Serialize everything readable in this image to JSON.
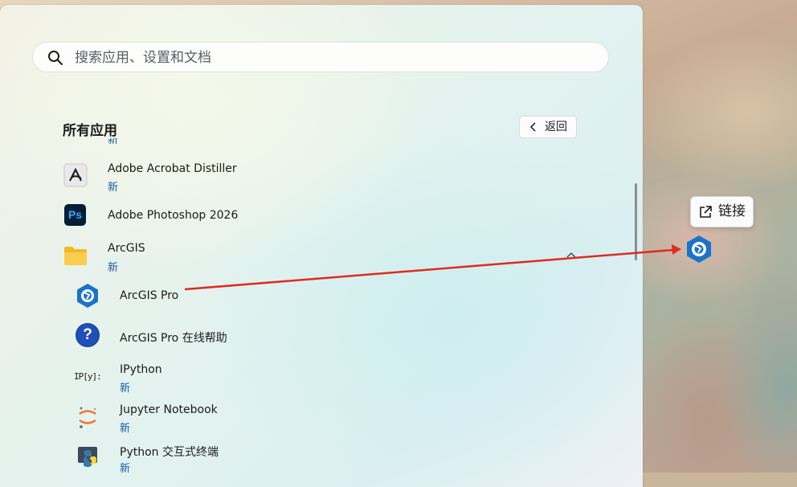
{
  "search": {
    "placeholder": "搜索应用、设置和文档"
  },
  "section": {
    "title": "所有应用"
  },
  "back_button": {
    "label": "返回"
  },
  "new_badge": "新",
  "apps": [
    {
      "name": "Adobe Acrobat Distiller",
      "badge": "新",
      "icon": "acrobat-distiller-icon"
    },
    {
      "name": "Adobe Photoshop 2026",
      "badge": "",
      "icon": "photoshop-icon",
      "icon_text": "Ps"
    },
    {
      "name": "ArcGIS",
      "badge": "新",
      "icon": "folder-icon"
    },
    {
      "name": "ArcGIS Pro",
      "badge": "",
      "icon": "arcgis-pro-icon"
    },
    {
      "name": "ArcGIS Pro 在线帮助",
      "badge": "",
      "icon": "help-question-icon",
      "icon_text": "?"
    },
    {
      "name": "IPython",
      "badge": "新",
      "icon": "ipython-icon",
      "icon_text": "IP[y]:"
    },
    {
      "name": "Jupyter Notebook",
      "badge": "新",
      "icon": "jupyter-icon"
    },
    {
      "name": "Python 交互式终端",
      "badge": "新",
      "icon": "python-icon"
    }
  ],
  "drag_tooltip": {
    "label": "链接",
    "icon": "external-link-icon"
  },
  "colors": {
    "accent_new": "#1c5aa6",
    "arrow": "#e02b1f",
    "photoshop_bg": "#001e36",
    "photoshop_fg": "#31a8ff"
  }
}
